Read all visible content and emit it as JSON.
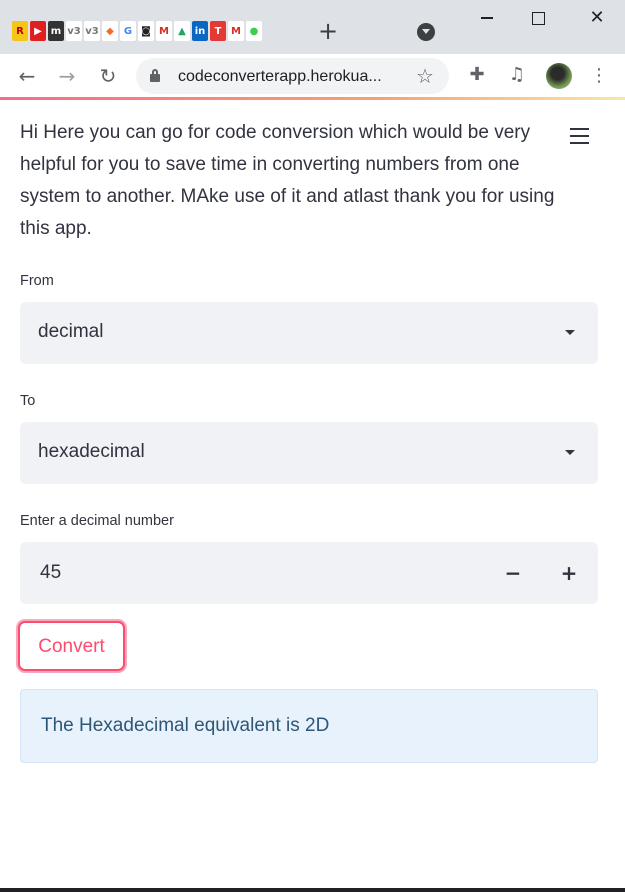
{
  "browser": {
    "tab_favicons": [
      {
        "name": "r-favicon",
        "glyph": "R",
        "color": "#f5c518",
        "fg": "#c00000"
      },
      {
        "name": "youtube-favicon",
        "glyph": "▶",
        "color": "#e02020",
        "fg": "#ffffff"
      },
      {
        "name": "tt-favicon",
        "glyph": "m",
        "color": "#333333",
        "fg": "#ffffff"
      },
      {
        "name": "v3-favicon",
        "glyph": "v3",
        "color": "#ffffff",
        "fg": "#777777"
      },
      {
        "name": "v3-favicon",
        "glyph": "v3",
        "color": "#ffffff",
        "fg": "#777777"
      },
      {
        "name": "figma-favicon",
        "glyph": "◆",
        "color": "#ffffff",
        "fg": "#f06c2c"
      },
      {
        "name": "google-favicon",
        "glyph": "G",
        "color": "#ffffff",
        "fg": "#4285f4"
      },
      {
        "name": "incognito-favicon",
        "glyph": "◙",
        "color": "#ffffff",
        "fg": "#202124"
      },
      {
        "name": "gmail-favicon",
        "glyph": "M",
        "color": "#ffffff",
        "fg": "#d93025"
      },
      {
        "name": "drive-favicon",
        "glyph": "▲",
        "color": "#ffffff",
        "fg": "#1fa463"
      },
      {
        "name": "linkedin-favicon",
        "glyph": "in",
        "color": "#0a66c2",
        "fg": "#ffffff"
      },
      {
        "name": "t-favicon",
        "glyph": "T",
        "color": "#e53935",
        "fg": "#ffffff"
      },
      {
        "name": "gmail-favicon",
        "glyph": "M",
        "color": "#ffffff",
        "fg": "#d93025"
      },
      {
        "name": "green-favicon",
        "glyph": "●",
        "color": "#ffffff",
        "fg": "#3ccf4e"
      }
    ],
    "new_tab_glyph": "+",
    "close_glyph": "✕",
    "back_glyph": "←",
    "forward_glyph": "→",
    "reload_glyph": "↻",
    "url": "codeconverterapp.herokua...",
    "star_glyph": "☆",
    "extensions_glyph": "✚",
    "media_glyph": "♫",
    "menu_glyph": "⋮"
  },
  "app": {
    "intro": "Hi Here you can go for code conversion which would be very helpful for you to save time in converting numbers from one system to another. MAke use of it and atlast thank you for using this app.",
    "from_label": "From",
    "from_value": "decimal",
    "to_label": "To",
    "to_value": "hexadecimal",
    "number_label": "Enter a decimal number",
    "number_value": "45",
    "minus_glyph": "−",
    "plus_glyph": "+",
    "convert_label": "Convert",
    "result_text": "The Hexadecimal equivalent is 2D"
  },
  "colors": {
    "accent": "#ff4b6e",
    "input_bg": "#f0f2f6",
    "info_bg": "#e8f2fc",
    "info_text": "#2e5776"
  }
}
